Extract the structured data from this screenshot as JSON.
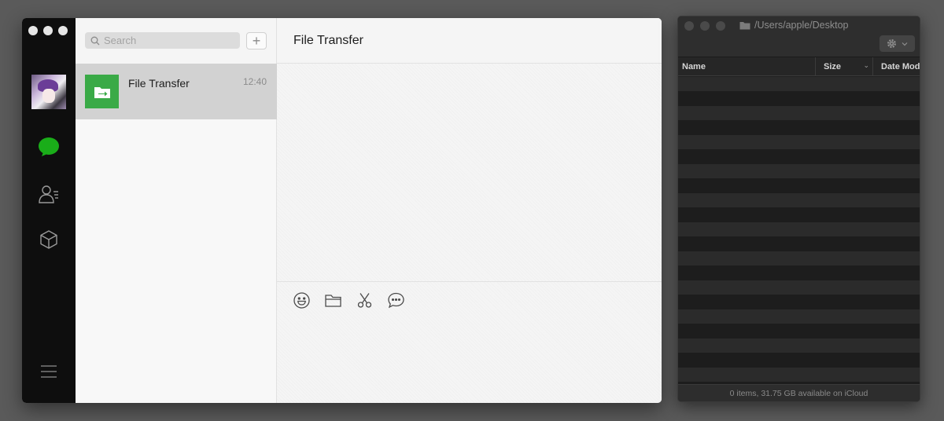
{
  "wechat": {
    "search": {
      "placeholder": "Search"
    },
    "add_button_label": "+",
    "nav": {
      "icons": [
        "chat-bubble-icon",
        "contacts-icon",
        "mini-programs-cube-icon",
        "menu-icon"
      ],
      "accent_color": "#1aad19"
    },
    "chats": [
      {
        "name": "File Transfer",
        "time": "12:40",
        "thumb_color": "#3aaa47"
      }
    ],
    "conversation": {
      "title": "File Transfer",
      "tools": [
        "emoji-icon",
        "folder-icon",
        "scissors-icon",
        "chat-history-icon"
      ]
    }
  },
  "finder": {
    "path": "/Users/apple/Desktop",
    "columns": [
      "Name",
      "Size",
      "Date Mod"
    ],
    "status": "0 items, 31.75 GB available on iCloud"
  }
}
